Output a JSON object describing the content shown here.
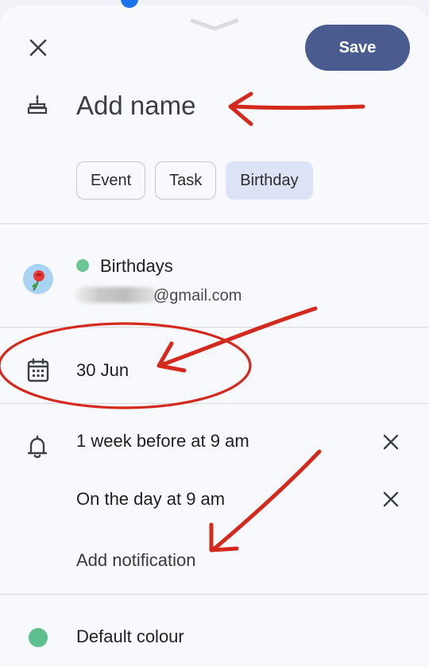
{
  "header": {
    "save_label": "Save"
  },
  "title": {
    "placeholder": "Add name"
  },
  "type_chips": [
    {
      "label": "Event",
      "selected": false
    },
    {
      "label": "Task",
      "selected": false
    },
    {
      "label": "Birthday",
      "selected": true
    }
  ],
  "calendar": {
    "name": "Birthdays",
    "color": "#6cc595",
    "email_domain": "@gmail.com"
  },
  "date": {
    "value": "30 Jun"
  },
  "notifications": {
    "items": [
      {
        "label": "1 week before at 9 am"
      },
      {
        "label": "On the day at 9 am"
      }
    ],
    "add_label": "Add notification"
  },
  "colour": {
    "label": "Default colour",
    "color": "#5cc08e"
  },
  "icons": {
    "close": "close-icon",
    "cake": "cake-icon",
    "calendar": "calendar-icon",
    "bell": "bell-icon",
    "remove": "close-icon"
  },
  "theme": {
    "save_button": "#4a5b8f",
    "selected_chip": "#dde3f6",
    "annotation_red": "#d42a1e"
  }
}
